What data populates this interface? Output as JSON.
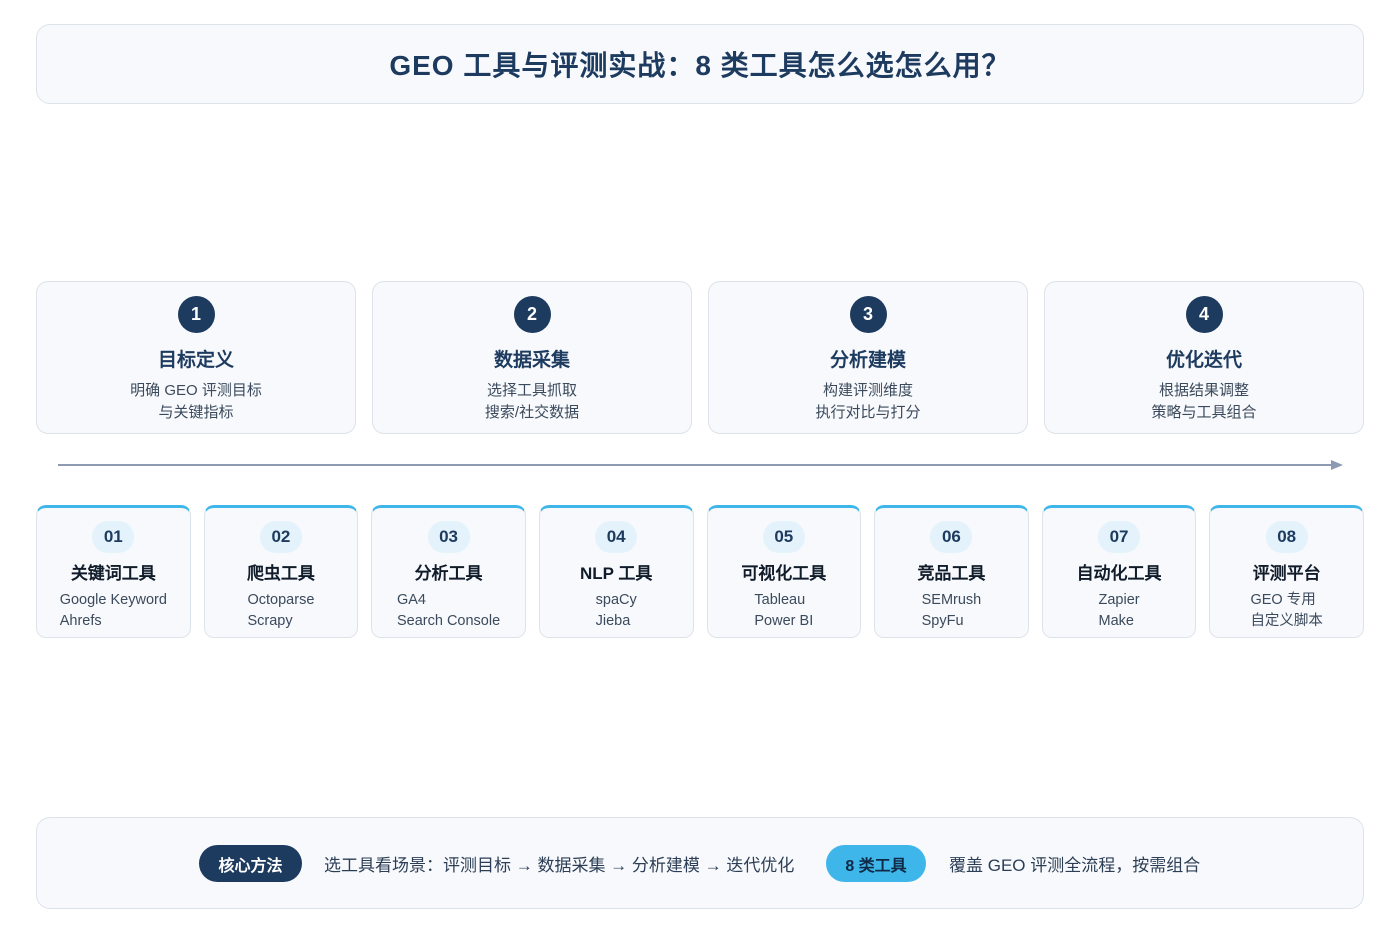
{
  "title": "GEO 工具与评测实战：8 类工具怎么选怎么用？",
  "steps": [
    {
      "num": "1",
      "title": "目标定义",
      "line1": "明确 GEO 评测目标",
      "line2": "与关键指标"
    },
    {
      "num": "2",
      "title": "数据采集",
      "line1": "选择工具抓取",
      "line2": "搜索/社交数据"
    },
    {
      "num": "3",
      "title": "分析建模",
      "line1": "构建评测维度",
      "line2": "执行对比与打分"
    },
    {
      "num": "4",
      "title": "优化迭代",
      "line1": "根据结果调整",
      "line2": "策略与工具组合"
    }
  ],
  "tools": [
    {
      "num": "01",
      "title": "关键词工具",
      "item1": "Google Keyword",
      "item2": "Ahrefs"
    },
    {
      "num": "02",
      "title": "爬虫工具",
      "item1": "Octoparse",
      "item2": "Scrapy"
    },
    {
      "num": "03",
      "title": "分析工具",
      "item1": "GA4",
      "item2": "Search Console"
    },
    {
      "num": "04",
      "title": "NLP 工具",
      "item1": "spaCy",
      "item2": "Jieba"
    },
    {
      "num": "05",
      "title": "可视化工具",
      "item1": "Tableau",
      "item2": "Power BI"
    },
    {
      "num": "06",
      "title": "竞品工具",
      "item1": "SEMrush",
      "item2": "SpyFu"
    },
    {
      "num": "07",
      "title": "自动化工具",
      "item1": "Zapier",
      "item2": "Make"
    },
    {
      "num": "08",
      "title": "评测平台",
      "item1": "GEO 专用",
      "item2": "自定义脚本"
    }
  ],
  "footer": {
    "badge1": "核心方法",
    "text1": "选工具看场景：评测目标 → 数据采集 → 分析建模 → 迭代优化",
    "badge2": "8 类工具",
    "text2": "覆盖 GEO 评测全流程，按需组合"
  },
  "colors": {
    "navy": "#1d3a5f",
    "accent": "#3fb6ea",
    "card_bg": "#f7f9fc",
    "arrow": "#8c9bb3"
  }
}
